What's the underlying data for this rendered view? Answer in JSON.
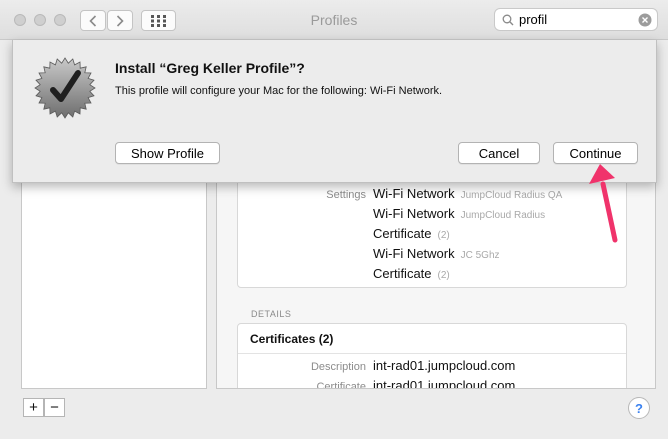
{
  "window": {
    "title": "Profiles",
    "search": {
      "value": "profil",
      "placeholder": "Search"
    }
  },
  "sheet": {
    "title": "Install “Greg Keller Profile”?",
    "message": "This profile will configure your Mac for the following: Wi-Fi Network.",
    "buttons": {
      "show_profile": "Show Profile",
      "cancel": "Cancel",
      "continue": "Continue"
    }
  },
  "settings": {
    "label": "Settings",
    "rows": [
      {
        "name": "Wi-Fi Network",
        "detail": "JumpCloud Radius QA"
      },
      {
        "name": "Wi-Fi Network",
        "detail": "JumpCloud Radius"
      },
      {
        "name": "Certificate",
        "detail": "(2)"
      },
      {
        "name": "Wi-Fi Network",
        "detail": "JC 5Ghz"
      },
      {
        "name": "Certificate",
        "detail": "(2)"
      }
    ]
  },
  "details": {
    "heading": "DETAILS",
    "certificates_title": "Certificates (2)",
    "description_label": "Description",
    "description_value": "int-rad01.jumpcloud.com",
    "certificate_label": "Certificate",
    "certificate_value": "int-rad01.jumpcloud.com"
  },
  "footer": {
    "add": "+",
    "remove": "−",
    "help": "?"
  },
  "colors": {
    "annotation_arrow": "#f0336b",
    "help_blue": "#3b82f0"
  }
}
